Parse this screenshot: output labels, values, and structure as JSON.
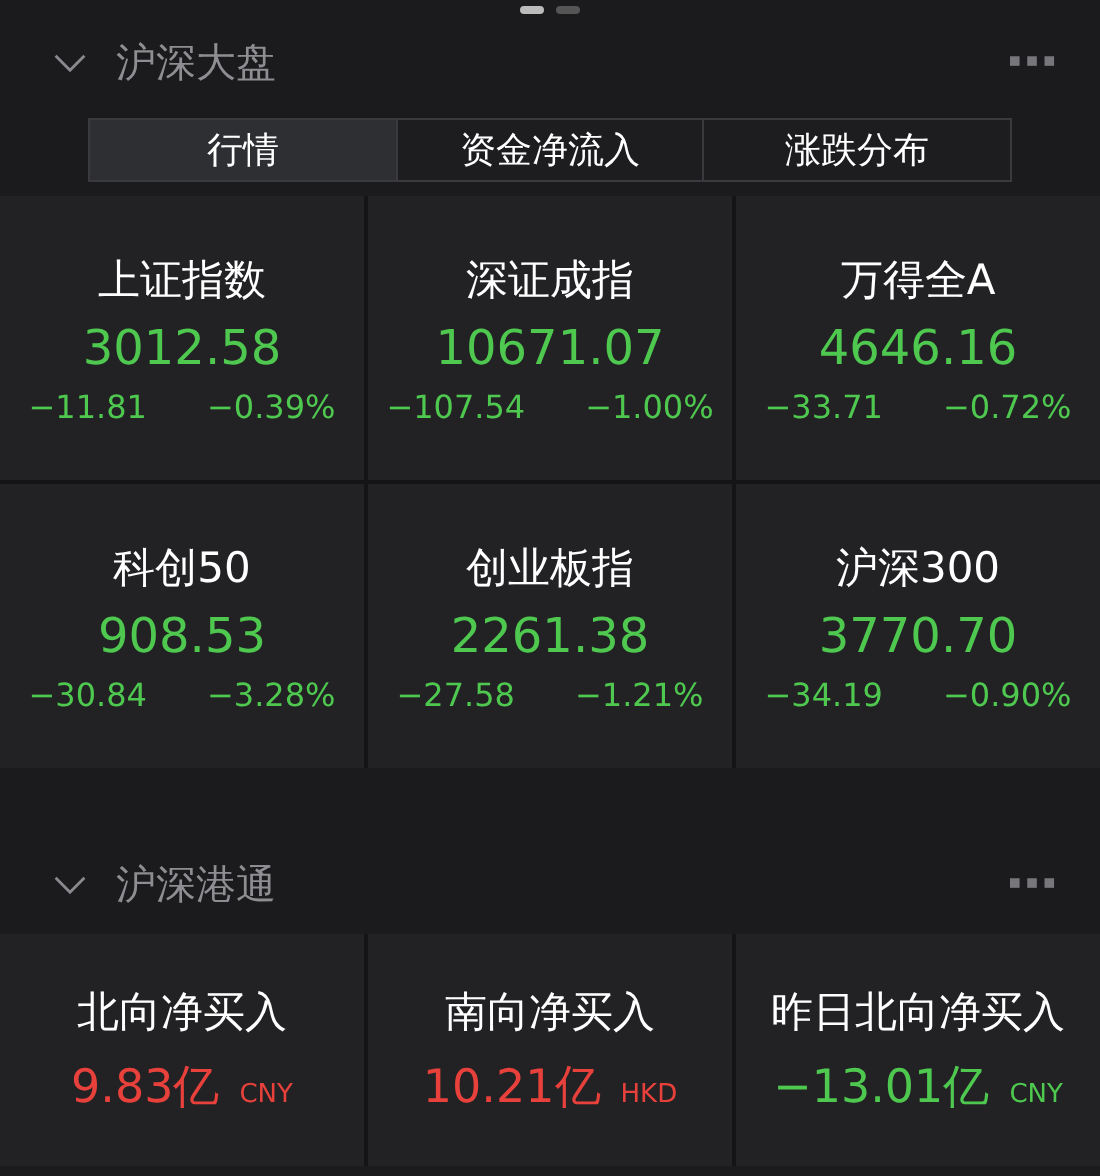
{
  "pager": [
    {
      "selected": true
    },
    {
      "selected": false
    }
  ],
  "sections": [
    {
      "title": "沪深大盘",
      "expanded": true,
      "tabs": [
        {
          "label": "行情",
          "selected": true
        },
        {
          "label": "资金净流入",
          "selected": false
        },
        {
          "label": "涨跌分布",
          "selected": false
        }
      ],
      "indices": [
        {
          "name": "上证指数",
          "value": "3012.58",
          "change": "−11.81",
          "percent": "−0.39%",
          "color": "#4fc84f"
        },
        {
          "name": "深证成指",
          "value": "10671.07",
          "change": "−107.54",
          "percent": "−1.00%",
          "color": "#4fc84f"
        },
        {
          "name": "万得全A",
          "value": "4646.16",
          "change": "−33.71",
          "percent": "−0.72%",
          "color": "#4fc84f"
        },
        {
          "name": "科创50",
          "value": "908.53",
          "change": "−30.84",
          "percent": "−3.28%",
          "color": "#4fc84f"
        },
        {
          "name": "创业板指",
          "value": "2261.38",
          "change": "−27.58",
          "percent": "−1.21%",
          "color": "#4fc84f"
        },
        {
          "name": "沪深300",
          "value": "3770.70",
          "change": "−34.19",
          "percent": "−0.90%",
          "color": "#4fc84f"
        }
      ]
    },
    {
      "title": "沪深港通",
      "expanded": true,
      "flows": [
        {
          "name": "北向净买入",
          "value": "9.83亿",
          "currency": "CNY",
          "color": "#e8413b"
        },
        {
          "name": "南向净买入",
          "value": "10.21亿",
          "currency": "HKD",
          "color": "#e8413b"
        },
        {
          "name": "昨日北向净买入",
          "value": "−13.01亿",
          "currency": "CNY",
          "color": "#4fc84f"
        }
      ]
    }
  ]
}
